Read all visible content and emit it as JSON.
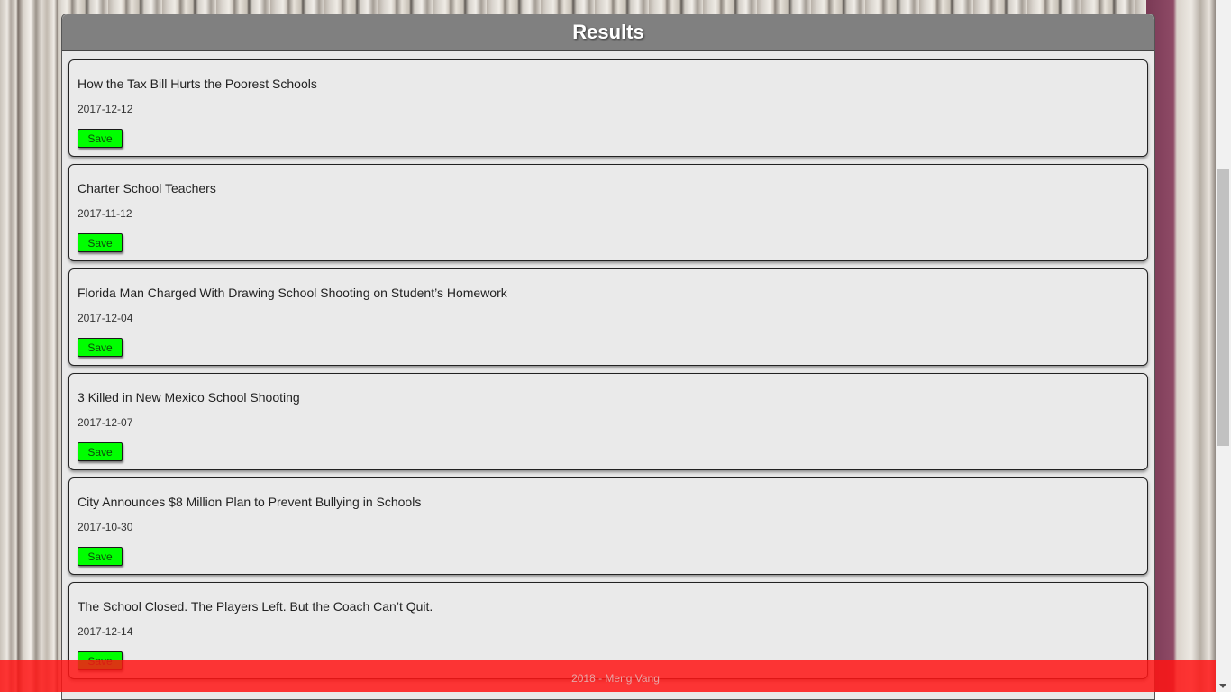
{
  "header": {
    "title": "Results"
  },
  "results": [
    {
      "title": "How the Tax Bill Hurts the Poorest Schools",
      "date": "2017-12-12",
      "save_label": "Save"
    },
    {
      "title": "Charter School Teachers",
      "date": "2017-11-12",
      "save_label": "Save"
    },
    {
      "title": "Florida Man Charged With Drawing School Shooting on Student’s Homework",
      "date": "2017-12-04",
      "save_label": "Save"
    },
    {
      "title": "3 Killed in New Mexico School Shooting",
      "date": "2017-12-07",
      "save_label": "Save"
    },
    {
      "title": "City Announces $8 Million Plan to Prevent Bullying in Schools",
      "date": "2017-10-30",
      "save_label": "Save"
    },
    {
      "title": "The School Closed. The Players Left. But the Coach Can’t Quit.",
      "date": "2017-12-14",
      "save_label": "Save"
    }
  ],
  "footer": {
    "text": "2018 - Meng Vang"
  },
  "colors": {
    "save_button": "#00ff00",
    "header": "#808080",
    "footer": "#ff1414"
  }
}
